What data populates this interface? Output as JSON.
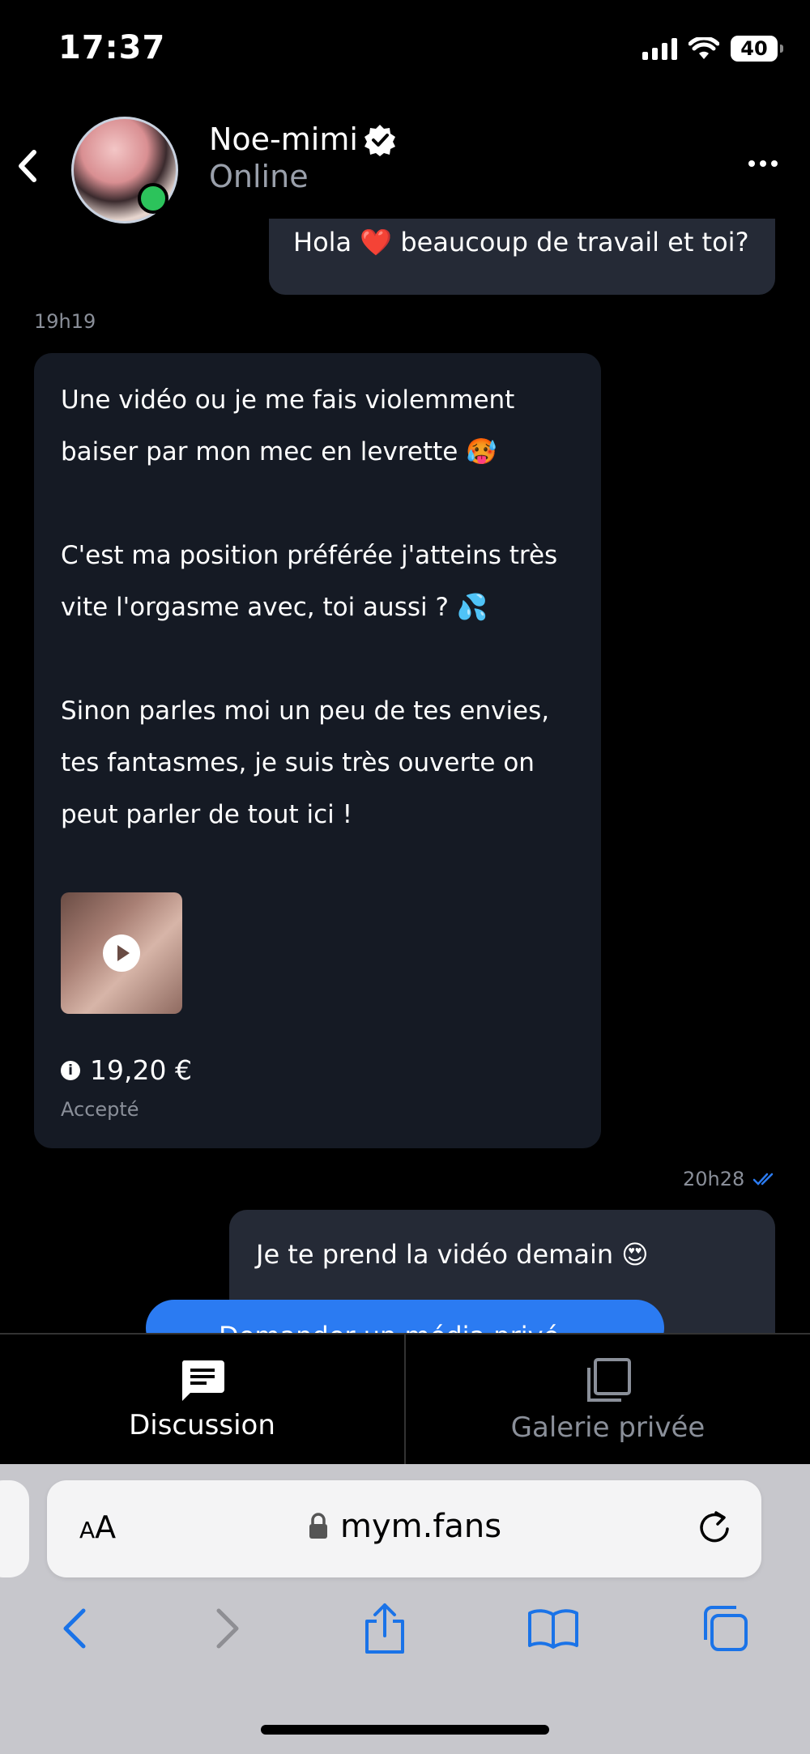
{
  "status_bar": {
    "time": "17:37",
    "battery": "40"
  },
  "header": {
    "name": "Noe-mimi",
    "presence": "Online"
  },
  "messages": {
    "out_top_text": "Hola ❤️ beaucoup de travail et toi?",
    "timestamp_1": "19h19",
    "in_lines": [
      "Une vidéo ou je me fais violemment",
      "baiser par mon mec en levrette 🥵",
      "C'est ma position préférée j'atteins très",
      "vite l'orgasme avec, toi aussi ? 💦",
      "Sinon parles moi un peu de tes envies,",
      "tes fantasmes, je suis très ouverte on",
      "peut parler de tout ici !"
    ],
    "price": "19,20 €",
    "price_status": "Accepté",
    "timestamp_2": "20h28",
    "out_bottom_text": "Je te prend la vidéo demain 😍",
    "cta_text": "Demander un média privé"
  },
  "tabs": [
    {
      "label": "Discussion",
      "icon": "chat-icon",
      "active": true
    },
    {
      "label": "Galerie privée",
      "icon": "gallery-icon",
      "active": false
    }
  ],
  "safari": {
    "aa": "AA",
    "url": "mym.fans"
  },
  "colors": {
    "accent": "#2b7bf2",
    "online": "#2cc35b",
    "bubble_in": "#151a24",
    "bubble_out": "#252a36",
    "safari_blue": "#1a73e8"
  }
}
